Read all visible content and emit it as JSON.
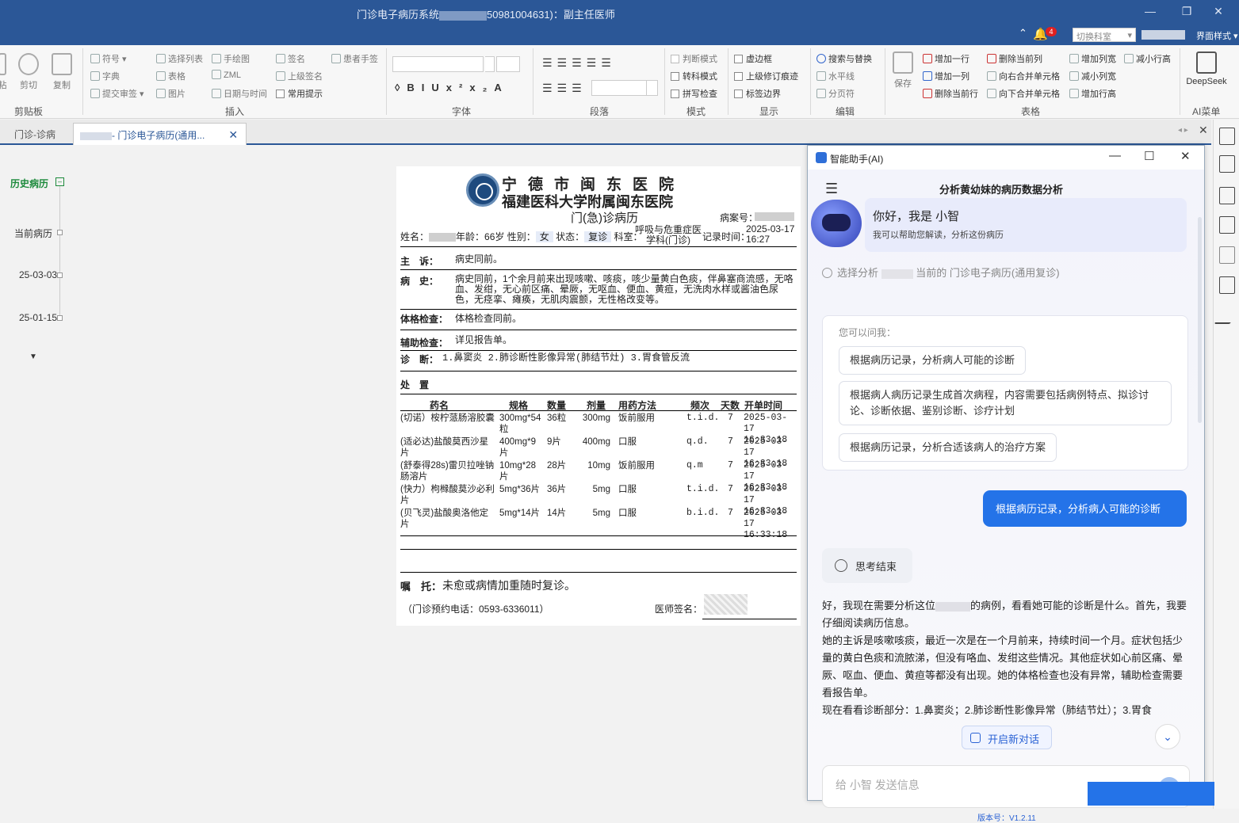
{
  "window": {
    "title_prefix": "门诊电子病历系统",
    "title_suffix": "50981004631)：副主任医师",
    "notif_count": "4",
    "dept_select": "切换科室",
    "ui_style": "界面样式"
  },
  "ribbon": {
    "clipboard": {
      "label": "剪贴板",
      "paste": "粘",
      "cut": "剪切",
      "copy": "复制"
    },
    "insert": {
      "label": "插入",
      "items": [
        "符号",
        "选择列表",
        "手绘图",
        "签名",
        "患者手签",
        "字典",
        "表格",
        "ZML",
        "上级签名",
        "提交审签",
        "图片",
        "日期与时间",
        "常用提示"
      ]
    },
    "font": {
      "label": "字体"
    },
    "paragraph": {
      "label": "段落"
    },
    "mode": {
      "label": "模式",
      "items": [
        "判断模式",
        "转科模式",
        "拼写检查"
      ]
    },
    "display": {
      "label": "显示",
      "items": [
        "虚边框",
        "上级修订痕迹",
        "标签边界"
      ]
    },
    "edit": {
      "label": "编辑",
      "items": [
        "搜索与替换",
        "水平线",
        "分页符"
      ]
    },
    "table": {
      "label": "表格",
      "save": "保存",
      "items": [
        "增加一行",
        "删除当前列",
        "增加列宽",
        "减小行高",
        "增加一列",
        "向右合并单元格",
        "减小列宽",
        "删除当前行",
        "向下合并单元格",
        "增加行高"
      ]
    },
    "ai": {
      "label": "AI菜单",
      "deepseek": "DeepSeek"
    }
  },
  "tabs": [
    {
      "label": "门诊-诊病"
    },
    {
      "label": "- 门诊电子病历(通用..."
    }
  ],
  "timeline": {
    "history_label": "历史病历",
    "items": [
      "当前病历",
      "25-03-03",
      "25-01-15"
    ]
  },
  "doc": {
    "hospital_name": "宁德市闽东医院",
    "hospital_sub": "福建医科大学附属闽东医院",
    "record_type": "门(急)诊病历",
    "record_no_label": "病案号：",
    "name_label": "姓名：",
    "age_label": "年龄：",
    "age": "66岁",
    "sex_label": "性别：",
    "sex": "女",
    "status_label": "状态：",
    "status": "复诊",
    "dept_label": "科室：",
    "dept": "呼吸与危重症医学科(门诊)",
    "time_label": "记录时间：",
    "time": "2025-03-17 16:27",
    "sections": [
      {
        "label": "主　诉：",
        "value": "病史同前。"
      },
      {
        "label": "病　史：",
        "value": "病史同前，1个余月前来出现咳嗽、咳痰，咳少量黄白色痰，伴鼻塞商流感，无咯血、发绀，无心前区痛、晕厥，无呕血、便血、黄疸，无洗肉水样或酱油色尿色，无痉挛、瘫痪，无肌肉震颤，无性格改变等。"
      },
      {
        "label": "体格检查：",
        "value": "体格检查同前。"
      },
      {
        "label": "辅助检查：",
        "value": "详见报告单。"
      },
      {
        "label": "诊　断：",
        "value": "1.鼻窦炎 2.肺诊断性影像异常(肺结节灶) 3.胃食管反流"
      },
      {
        "label": "处　置",
        "value": ""
      }
    ],
    "rx_headers": [
      "药名",
      "规格",
      "数量",
      "剂量",
      "用药方法",
      "频次",
      "天数",
      "开单时间"
    ],
    "rx_rows": [
      {
        "name": "(切诺）桉柠蒎肠溶胶囊",
        "spec": "300mg*54粒",
        "qty": "36粒",
        "dose": "300mg",
        "method": "饭前服用",
        "freq": "t.i.d.",
        "days": "7",
        "time": "2025-03-17 16:33:18"
      },
      {
        "name": "(适必达)盐酸莫西沙星片",
        "spec": "400mg*9片",
        "qty": "9片",
        "dose": "400mg",
        "method": "口服",
        "freq": "q.d.",
        "days": "7",
        "time": "2025-03-17 16:33:18"
      },
      {
        "name": "(舒泰得28s)雷贝拉唑钠肠溶片",
        "spec": "10mg*28片",
        "qty": "28片",
        "dose": "10mg",
        "method": "饭前服用",
        "freq": "q.m",
        "days": "7",
        "time": "2025-03-17 16:33:18"
      },
      {
        "name": "(快力）枸橼酸莫沙必利片",
        "spec": "5mg*36片",
        "qty": "36片",
        "dose": "5mg",
        "method": "口服",
        "freq": "t.i.d.",
        "days": "7",
        "time": "2025-03-17 16:33:18"
      },
      {
        "name": "(贝飞灵)盐酸奥洛他定片",
        "spec": "5mg*14片",
        "qty": "14片",
        "dose": "5mg",
        "method": "口服",
        "freq": "b.i.d.",
        "days": "7",
        "time": "2025-03-17 16:33:18"
      }
    ],
    "advice_label": "嘱　托：",
    "advice": "未愈或病情加重随时复诊。",
    "phone": "（门诊预约电话：0593-6336011）",
    "sign_label": "医师签名："
  },
  "ai": {
    "window_title": "智能助手(AI)",
    "heading": "分析黄幼妹的病历数据分析",
    "greet_title": "你好，我是 小智",
    "greet_sub": "我可以帮助您解读，分析这份病历",
    "selected_prefix": "选择分析",
    "selected_suffix": "当前的 门诊电子病历(通用复诊)",
    "ask_label": "您可以问我：",
    "suggestions": [
      "根据病历记录，分析病人可能的诊断",
      "根据病人病历记录生成首次病程，内容需要包括病例特点、拟诊讨论、诊断依据、鉴别诊断、诊疗计划",
      "根据病历记录，分析合适该病人的治疗方案"
    ],
    "user_msg": "根据病历记录，分析病人可能的诊断",
    "think_label": "思考结束",
    "answer_p1a": "好，我现在需要分析这位",
    "answer_p1b": "的病例，看看她可能的诊断是什么。首先，我要仔细阅读病历信息。",
    "answer_p2": "她的主诉是咳嗽咳痰，最近一次是在一个月前来，持续时间一个月。症状包括少量的黄白色痰和流脓涕，但没有咯血、发绀这些情况。其他症状如心前区痛、晕厥、呕血、便血、黄疸等都没有出现。她的体格检查也没有异常，辅助检查需要看报告单。",
    "answer_p3": "现在看看诊断部分：1.鼻窦炎；2.肺诊断性影像异常（肺结节灶）；3.胃食",
    "new_chat": "开启新对话",
    "input_placeholder": "给 小智 发送信息",
    "version": "版本号：V1.2.11"
  }
}
